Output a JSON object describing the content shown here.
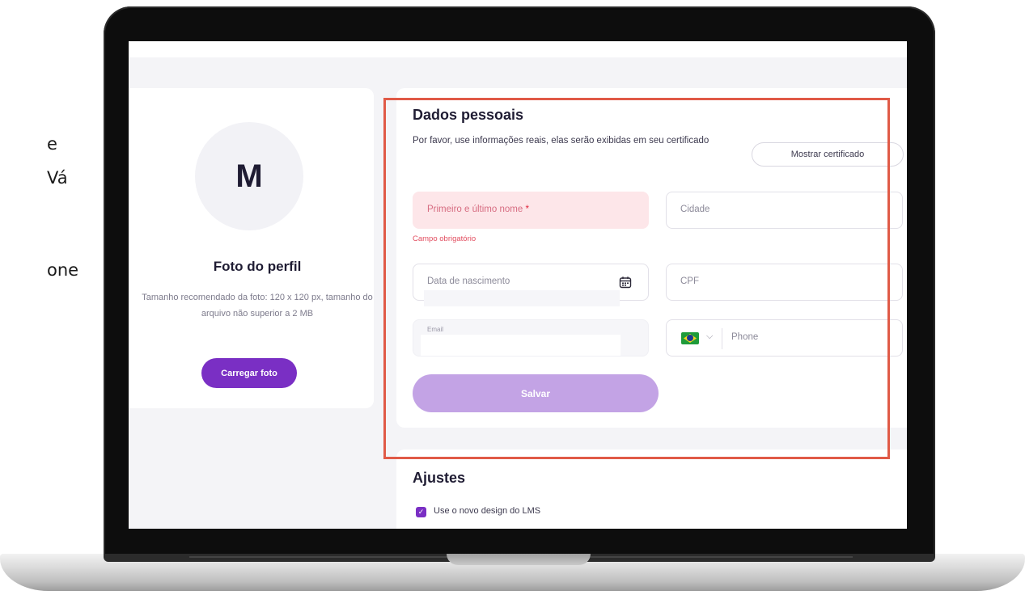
{
  "side_fragments": [
    "e",
    "Vá",
    "one"
  ],
  "profile": {
    "avatar_letter": "M",
    "title": "Foto do perfil",
    "hint": "Tamanho recomendado da foto: 120 x 120 px, tamanho do arquivo não superior a 2 MB",
    "upload_button": "Carregar foto"
  },
  "personal": {
    "title": "Dados pessoais",
    "info": "Por favor, use informações reais, elas serão exibidas em seu certificado",
    "certificate_button": "Mostrar certificado",
    "fields": {
      "name_placeholder": "Primeiro e último nome",
      "name_required": "*",
      "name_error": "Campo obrigatório",
      "city_placeholder": "Cidade",
      "birth_placeholder": "Data de nascimento",
      "cpf_placeholder": "CPF",
      "email_label": "Email",
      "phone_placeholder": "Phone"
    },
    "save_button": "Salvar"
  },
  "settings": {
    "title": "Ajustes",
    "new_design_label": "Use o novo design do LMS",
    "new_design_checked": true
  },
  "colors": {
    "accent": "#7a2fc4",
    "highlight": "#e05a47",
    "error": "#e24d5f"
  }
}
